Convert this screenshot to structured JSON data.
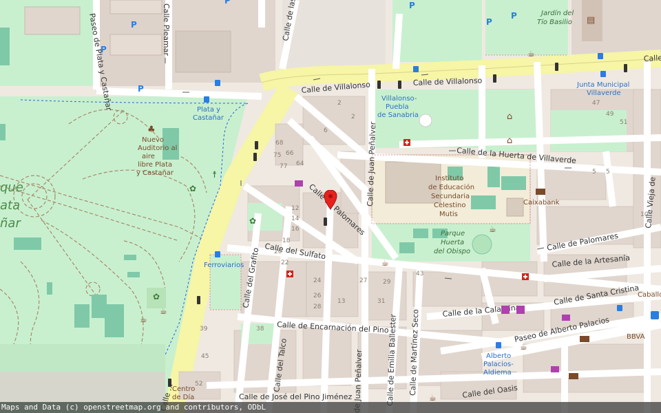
{
  "attribution": "Maps and Data (c) openstreetmap.org and contributors, ODbL",
  "colors": {
    "background": "#efe9e2",
    "park": "#c8f0cf",
    "block": "#e0d6ce",
    "main_road": "#f7f5a6",
    "road": "#ffffff",
    "marker": "#e8211d"
  },
  "labels": {
    "calle_villalonso_1": "Calle de Villalonso",
    "calle_villalonso_2": "Calle de Villalonso",
    "calle_villalonso_3": "Calle de",
    "paseo_plata": "Paseo de Plata y Castañar",
    "calle_pleamar": "Calle Pleamar",
    "calle_las": "Calle de las",
    "calle_palomares": "Calle de Palomares",
    "calle_palomares_e": "Calle de Palomares",
    "calle_sulfato": "Calle del Sulfato",
    "calle_grafito": "Calle del Grafito",
    "calle_juan_penalver": "Calle de Juan Peñalver",
    "calle_juan_penalver_s": "de Juan Peñalver",
    "calle_huerta": "Calle de la Huerta de Villaverde",
    "calle_vieja": "Calle Vieja de",
    "calle_artesania": "Calle de la Artesanía",
    "calle_santa_cristina": "Calle de Santa Cristina",
    "calle_calamina": "Calle de la Calamina",
    "calle_encarnacion": "Calle de Encarnación del Pino",
    "paseo_alberto": "Paseo de Alberto Palacios",
    "calle_talco": "Calle del Talco",
    "calle_martinez_seco": "Calle de Martínez Seco",
    "calle_emilia_ballester": "Calle de Emilia Ballester",
    "calle_jose_pino": "Calle de José del Pino Jiménez",
    "calle_oasis": "Calle del Oasis",
    "calle_bottom_left": "Calle ...",
    "jardin_1": "Jardín del",
    "jardin_2": "Tío Basilio",
    "auditorio_1": "Nuevo",
    "auditorio_2": "Auditorio al",
    "auditorio_3": "aire",
    "auditorio_4": "libre Plata",
    "auditorio_5": "y Castañar",
    "instituto_1": "Instituto",
    "instituto_2": "de Educación",
    "instituto_3": "Secundaria",
    "instituto_4": "Celestino",
    "instituto_5": "Mutis",
    "parque_1": "Parque",
    "parque_2": "Huerta",
    "parque_3": "del Obispo",
    "station_plata_1": "Plata y",
    "station_plata_2": "Castañar",
    "station_villalonso_1": "Villalonso-",
    "station_villalonso_2": "Puebla",
    "station_villalonso_3": "de Sanabria",
    "station_ferroviarios": "Ferroviarios",
    "station_alberto_1": "Alberto",
    "station_alberto_2": "Palacios-",
    "station_alberto_3": "Aldiema",
    "junta_1": "Junta Municipal",
    "junta_2": "Villaverde",
    "caixabank": "Caixabank",
    "bbva": "BBVA",
    "caballo": "Caballo",
    "centro_1": "Centro",
    "centro_2": "de Día",
    "park_big_1": "que",
    "park_big_2": "ata",
    "park_big_3": "ñar",
    "calle_las_palmas": "Calle de"
  },
  "house_numbers": [
    "68",
    "66",
    "64",
    "75",
    "77",
    "6",
    "8",
    "2",
    "4",
    "6",
    "12",
    "14",
    "16",
    "18",
    "20",
    "22",
    "24",
    "26",
    "28",
    "30",
    "34",
    "36",
    "38",
    "40",
    "43",
    "1",
    "3",
    "5",
    "7",
    "9",
    "11",
    "13",
    "15",
    "17",
    "19",
    "21",
    "23",
    "25",
    "27",
    "29",
    "31",
    "33",
    "35",
    "37",
    "39",
    "41",
    "45",
    "47",
    "49",
    "51",
    "52",
    "4",
    "3",
    "10",
    "12",
    "2",
    "5",
    "8"
  ],
  "icons": [
    "parking-icon",
    "bus-stop-icon",
    "theatre-icon",
    "museum-icon",
    "cafe-icon",
    "pharmacy-icon",
    "hospital-icon",
    "bank-icon",
    "shop-icon",
    "playground-icon",
    "library-icon",
    "fitness-icon",
    "bus-station-icon"
  ]
}
